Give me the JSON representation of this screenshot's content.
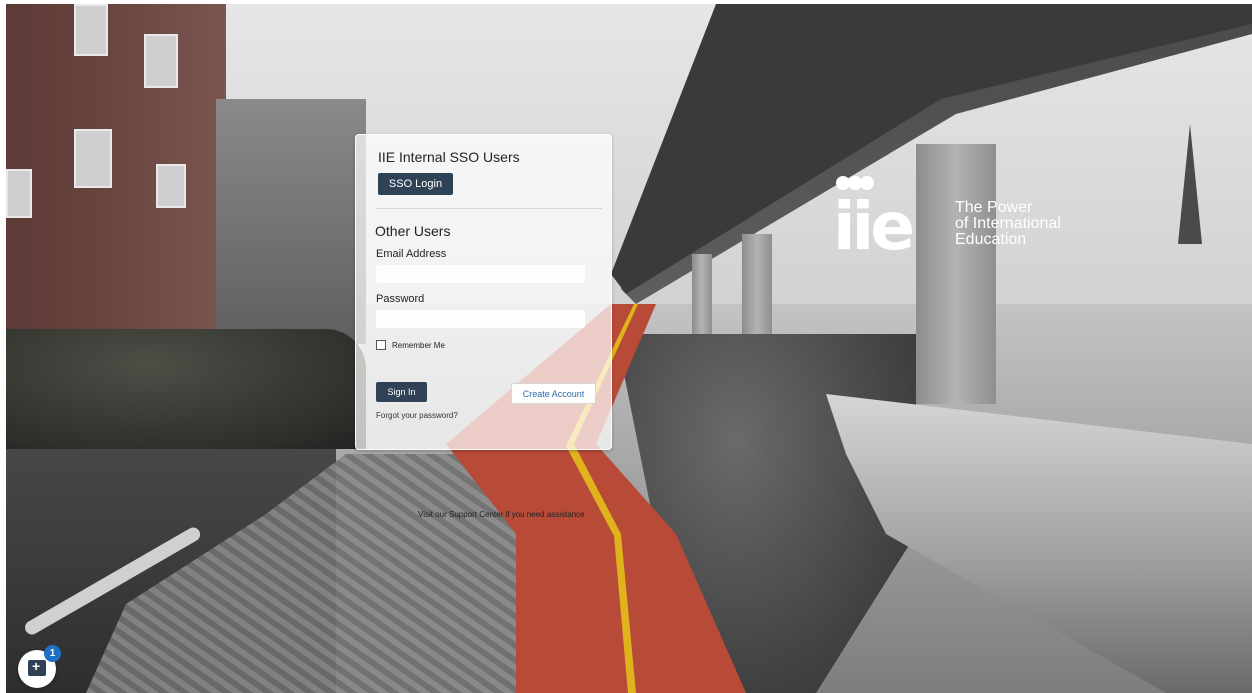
{
  "brand": {
    "tagline_line1": "The Power",
    "tagline_line2": "of International",
    "tagline_line3": "Education",
    "logo_name": "iie-logo"
  },
  "login": {
    "sso_heading": "IIE Internal SSO Users",
    "sso_button": "SSO Login",
    "other_heading": "Other Users",
    "email_label": "Email Address",
    "email_value": "",
    "password_label": "Password",
    "password_value": "",
    "remember_label": "Remember Me",
    "remember_checked": false,
    "sign_in_button": "Sign In",
    "create_account_button": "Create Account",
    "forgot_link": "Forgot your password?"
  },
  "footer": {
    "support_text": "Visit our Support Center if you need assistance"
  },
  "chat_widget": {
    "icon": "chat-add-icon",
    "badge_count": "1"
  },
  "colors": {
    "button_dark": "#2f4256",
    "link_blue": "#2f6aa8",
    "badge_blue": "#1f6fc4"
  }
}
